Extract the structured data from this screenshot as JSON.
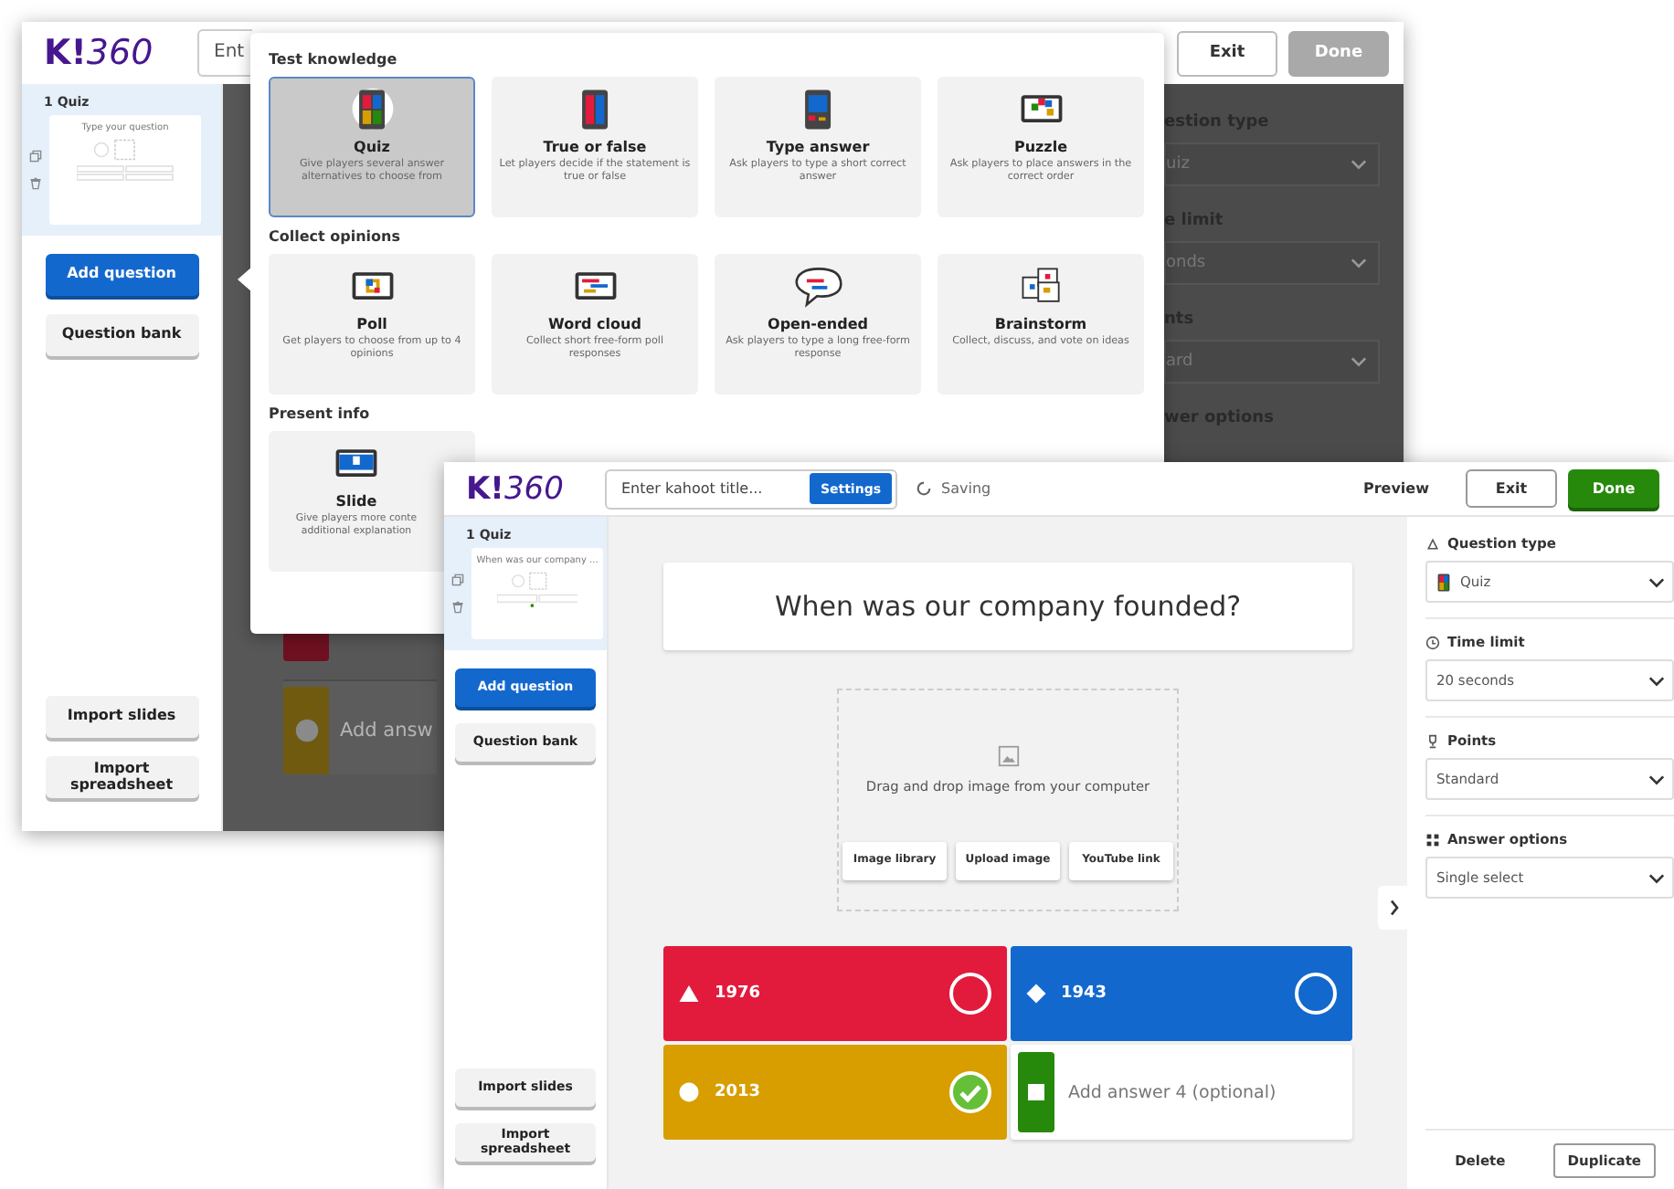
{
  "back_window": {
    "logo_mark": "K!",
    "logo_text": "360",
    "title_field": {
      "value": "Ent"
    },
    "header_buttons": [
      {
        "label": "Exit",
        "disabled": false
      },
      {
        "label": "Done",
        "disabled": true
      }
    ],
    "sidebar": {
      "slide": {
        "number": "1",
        "type": "Quiz",
        "preview": "Type your question",
        "selected": true
      },
      "buttons": [
        "Add question",
        "Question bank"
      ],
      "import_buttons": [
        "Import slides",
        "Import spreadsheet"
      ]
    },
    "canvas": {
      "answer_placeholder": "Add answ"
    },
    "settings_panel": [
      {
        "label": "estion type",
        "value": "uiz"
      },
      {
        "label": "e limit",
        "value": "onds"
      },
      {
        "label": "nts",
        "value": "ard"
      },
      {
        "label": "wer options"
      }
    ],
    "question_type_menu": [
      {
        "title": "Test knowledge",
        "items": [
          {
            "kind": "quiz",
            "name": "Quiz",
            "description": "Give players several answer alternatives to choose from",
            "selected": true
          },
          {
            "kind": "true_false",
            "name": "True or false",
            "description": "Let players decide if the statement is true or false",
            "selected": false
          },
          {
            "kind": "type_answer",
            "name": "Type answer",
            "description": "Ask players to type a short correct answer",
            "selected": false
          },
          {
            "kind": "puzzle",
            "name": "Puzzle",
            "description": "Ask players to place answers in the correct order",
            "selected": false
          }
        ]
      },
      {
        "title": "Collect opinions",
        "items": [
          {
            "kind": "poll",
            "name": "Poll",
            "description": "Get players to choose from up to 4 opinions",
            "selected": false
          },
          {
            "kind": "word_cloud",
            "name": "Word cloud",
            "description": "Collect short free-form poll responses",
            "selected": false
          },
          {
            "kind": "open_ended",
            "name": "Open-ended",
            "description": "Ask players to type a long free-form response",
            "selected": false
          },
          {
            "kind": "brainstorm",
            "name": "Brainstorm",
            "description": "Collect, discuss, and vote on ideas",
            "selected": false
          }
        ]
      },
      {
        "title": "Present info",
        "items": [
          {
            "kind": "slide",
            "name": "Slide",
            "description": "Give players more conte additional explanation",
            "selected": false
          }
        ]
      }
    ]
  },
  "front_window": {
    "logo_mark": "K!",
    "logo_text": "360",
    "title_field": {
      "placeholder": "Enter kahoot title..."
    },
    "settings_button": "Settings",
    "status": "Saving",
    "header_buttons": [
      {
        "label": "Preview",
        "kind": "link"
      },
      {
        "label": "Exit",
        "kind": "outline"
      },
      {
        "label": "Done",
        "kind": "primary"
      }
    ],
    "sidebar": {
      "slide": {
        "number": "1",
        "type": "Quiz",
        "preview": "When was our company ...",
        "selected": true
      },
      "buttons": [
        "Add question",
        "Question bank"
      ],
      "import_buttons": [
        "Import slides",
        "Import spreadsheet"
      ]
    },
    "question": "When was our company founded?",
    "media": {
      "hint": "Drag and drop image from your computer",
      "buttons": [
        "Image library",
        "Upload image",
        "YouTube link"
      ]
    },
    "answers": [
      {
        "kind": "filled",
        "text": "1976",
        "color": "#e21b3c",
        "correct": false
      },
      {
        "kind": "filled",
        "text": "1943",
        "color": "#1368ce",
        "correct": false
      },
      {
        "kind": "filled",
        "text": "2013",
        "color": "#d89e00",
        "correct": true
      },
      {
        "kind": "empty",
        "placeholder": "Add answer 4 (optional)",
        "color": "#26890c"
      }
    ],
    "settings_panel": [
      {
        "kind": "question_type",
        "label": "Question type",
        "value": "Quiz"
      },
      {
        "kind": "time_limit",
        "label": "Time limit",
        "value": "20 seconds"
      },
      {
        "kind": "points",
        "label": "Points",
        "value": "Standard"
      },
      {
        "kind": "answer_options",
        "label": "Answer options",
        "value": "Single select"
      }
    ],
    "footer_buttons": [
      "Delete",
      "Duplicate"
    ]
  }
}
